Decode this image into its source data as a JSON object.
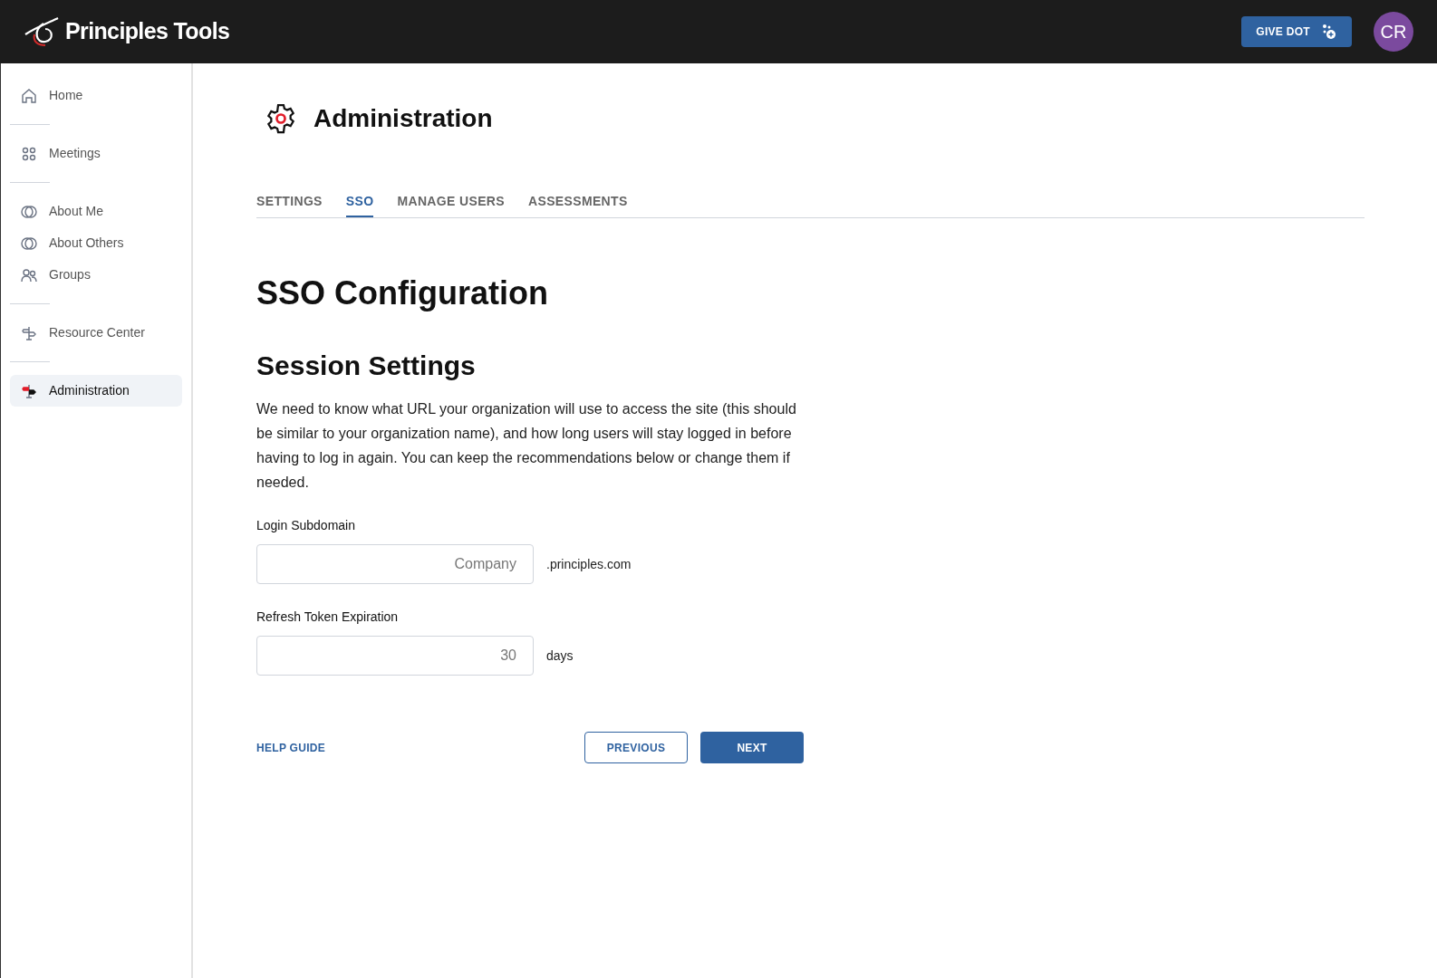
{
  "header": {
    "logo_text": "Principles Tools",
    "give_button": "GIVE DOT",
    "avatar": "CR"
  },
  "sidebar": {
    "groups": [
      [
        {
          "label": "Home",
          "selected": false
        }
      ],
      [
        {
          "label": "Meetings",
          "selected": false
        }
      ],
      [
        {
          "label": "About Me",
          "selected": false
        },
        {
          "label": "About Others",
          "selected": false
        },
        {
          "label": "Groups",
          "selected": false
        }
      ],
      [
        {
          "label": "Resource Center",
          "selected": false
        }
      ],
      [
        {
          "label": "Administration",
          "selected": true
        }
      ]
    ]
  },
  "page": {
    "title": "Administration"
  },
  "tabs": [
    {
      "label": "SETTINGS",
      "selected": false
    },
    {
      "label": "SSO",
      "selected": true
    },
    {
      "label": "MANAGE USERS",
      "selected": false
    },
    {
      "label": "ASSESSMENTS",
      "selected": false
    }
  ],
  "content": {
    "heading": "SSO Configuration",
    "subheading": "Session Settings",
    "description": "We need to know what URL your organization will use to access the site (this should be similar to your organization name), and how long users will stay logged in before having to log in again. You can keep the recommendations below or change them if needed.",
    "fields": [
      {
        "label": "Login Subdomain",
        "placeholder": "Company",
        "suffix": ".principles.com"
      },
      {
        "label": "Refresh Token Expiration",
        "placeholder": "30",
        "suffix": "days"
      }
    ],
    "help_link": "HELP GUIDE",
    "previous_button": "PREVIOUS",
    "next_button": "NEXT"
  }
}
